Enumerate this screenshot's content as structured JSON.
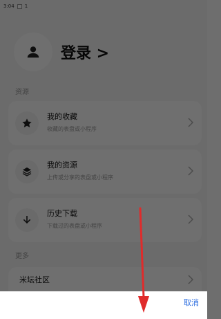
{
  "status_bar": {
    "time": "3:04",
    "badge": "1"
  },
  "login": {
    "label": "登录 >"
  },
  "sections": {
    "resources": "资源",
    "more": "更多"
  },
  "cards": [
    {
      "title": "我的收藏",
      "subtitle": "收藏的表盘或小程序",
      "icon": "star-icon"
    },
    {
      "title": "我的资源",
      "subtitle": "上传或分享的表盘或小程序",
      "icon": "layers-icon"
    },
    {
      "title": "历史下载",
      "subtitle": "下载过的表盘或小程序",
      "icon": "download-icon"
    }
  ],
  "more_items": [
    {
      "title": "米坛社区"
    }
  ],
  "sheet": {
    "cancel_label": "取消"
  },
  "colors": {
    "accent": "#2f6fe0",
    "annotation_arrow": "#e02b2b"
  }
}
